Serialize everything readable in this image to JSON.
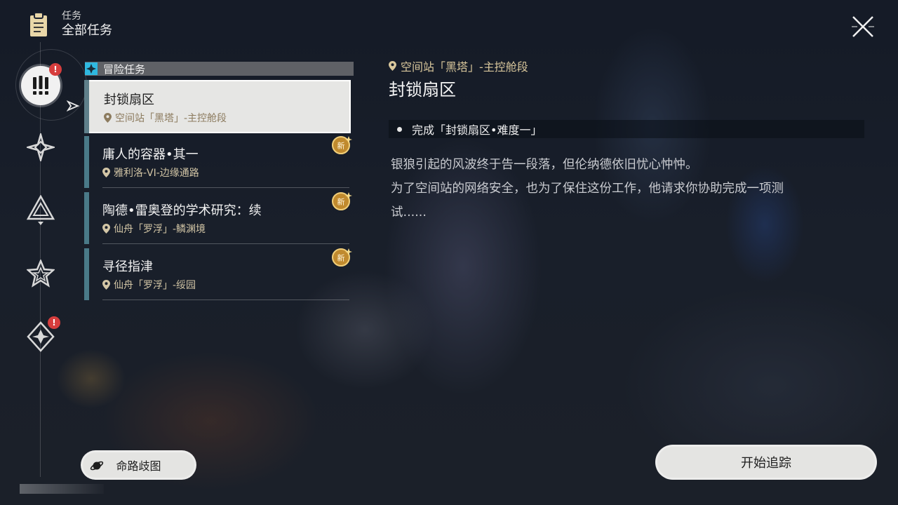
{
  "header": {
    "sub_label": "任务",
    "title": "全部任务",
    "icon": "clipboard-icon"
  },
  "rail": {
    "items": [
      {
        "name": "adventure-quests",
        "icon": "exclamation-icon",
        "active": true,
        "alert": "!"
      },
      {
        "name": "trailblaze-quests",
        "icon": "diamond-star-icon",
        "active": false
      },
      {
        "name": "companion-quests",
        "icon": "triangle-icon",
        "active": false
      },
      {
        "name": "event-quests",
        "icon": "star-icon",
        "active": false
      },
      {
        "name": "daily-quests",
        "icon": "compass-diamond-icon",
        "active": false,
        "alert": "!"
      }
    ]
  },
  "category": {
    "label": "冒险任务",
    "color": "#2fb8e0"
  },
  "quests": [
    {
      "title": "封锁扇区",
      "location": "空间站「黑塔」-主控舱段",
      "selected": true,
      "new": false
    },
    {
      "title": "庸人的容器•其一",
      "location": "雅利洛-VI-边缘通路",
      "selected": false,
      "new": true,
      "new_label": "新"
    },
    {
      "title": "陶德•雷奥登的学术研究：续",
      "location": "仙舟「罗浮」-鳞渊境",
      "selected": false,
      "new": true,
      "new_label": "新"
    },
    {
      "title": "寻径指津",
      "location": "仙舟「罗浮」-绥园",
      "selected": false,
      "new": true,
      "new_label": "新"
    }
  ],
  "detail": {
    "location": "空间站「黑塔」-主控舱段",
    "title": "封锁扇区",
    "objective": "完成「封锁扇区•难度一」",
    "description_lines": [
      "银狼引起的风波终于告一段落，但伦纳德依旧忧心忡忡。",
      "为了空间站的网络安全，也为了保住这份工作，他请求你协助完成一项测",
      "试......"
    ]
  },
  "buttons": {
    "path": "命路歧图",
    "track": "开始追踪"
  }
}
